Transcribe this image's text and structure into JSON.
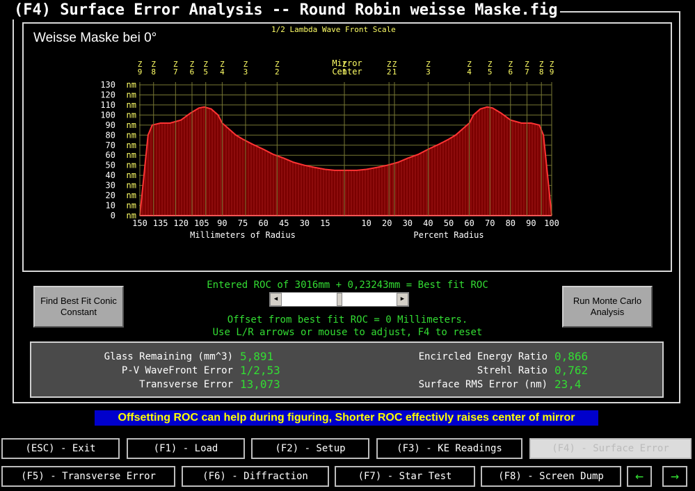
{
  "window": {
    "title": "(F4) Surface Error Analysis -- Round Robin weisse Maske.fig"
  },
  "chart": {
    "heading": "Weisse Maske bei 0°",
    "scale_label": "1/2 Lambda Wave Front Scale"
  },
  "chart_data": {
    "type": "area",
    "title": "Weisse Maske bei 0°",
    "subtitle": "1/2 Lambda Wave Front Scale",
    "y_unit": "nm",
    "ylim": [
      0,
      130
    ],
    "y_ticks": [
      "130 nm",
      "120 nm",
      "110 nm",
      "100 nm",
      "90 nm",
      "80 nm",
      "70 nm",
      "60 nm",
      "50 nm",
      "40 nm",
      "30 nm",
      "20 nm",
      "10 nm",
      "0 nm"
    ],
    "x_ticks_left": [
      "150",
      "135",
      "120",
      "105",
      "90",
      "75",
      "60",
      "45",
      "30",
      "15"
    ],
    "x_ticks_right": [
      "10",
      "20",
      "30",
      "40",
      "50",
      "60",
      "70",
      "80",
      "90",
      "100"
    ],
    "xlabel_left": "Millimeters of Radius",
    "xlabel_right": "Percent Radius",
    "zone_labels_left": [
      "Z9",
      "Z8",
      "Z7",
      "Z6",
      "Z5",
      "Z4",
      "Z3",
      "Z2",
      "Z1"
    ],
    "zone_labels_right": [
      "Z1",
      "Z2",
      "Z3",
      "Z4",
      "Z5",
      "Z6",
      "Z7",
      "Z8",
      "Z9"
    ],
    "center_label": [
      "Mirror",
      "Center"
    ],
    "x": [
      150,
      147,
      144,
      141,
      135,
      128,
      120,
      113,
      107,
      103,
      98,
      93,
      90,
      85,
      80,
      75,
      68,
      60,
      53,
      45,
      38,
      30,
      23,
      15,
      8,
      0
    ],
    "profile_nm": [
      0,
      40,
      80,
      90,
      92,
      92,
      95,
      102,
      107,
      108,
      106,
      100,
      92,
      86,
      80,
      76,
      71,
      66,
      61,
      57,
      53,
      50,
      48,
      46,
      45,
      45
    ]
  },
  "roc": {
    "entered": "Entered ROC of 3016mm + 0,23243mm = Best fit ROC",
    "offset": "Offset from best fit ROC = 0 Millimeters.",
    "hint": "Use L/R arrows or mouse to adjust, F4 to reset"
  },
  "buttons": {
    "find_conic": "Find Best Fit Conic Constant",
    "monte_carlo": "Run Monte Carlo Analysis"
  },
  "stats": {
    "glass_label": "Glass Remaining (mm^3)",
    "glass_value": "5,891",
    "pv_label": "P-V WaveFront Error",
    "pv_value": "1/2,53",
    "transverse_label": "Transverse Error",
    "transverse_value": "13,073",
    "energy_label": "Encircled Energy Ratio",
    "energy_value": "0,866",
    "strehl_label": "Strehl Ratio",
    "strehl_value": "0,762",
    "rms_label": "Surface RMS Error (nm)",
    "rms_value": "23,4"
  },
  "message": "Offsetting ROC can help during figuring, Shorter ROC effectivly raises center of mirror",
  "fkeys": {
    "esc": "(ESC) - Exit",
    "f1": "(F1) - Load",
    "f2": "(F2) - Setup",
    "f3": "(F3) - KE Readings",
    "f4": "(F4) - Surface Error",
    "f5": "(F5) - Transverse Error",
    "f6": "(F6) - Diffraction",
    "f7": "(F7) - Star Test",
    "f8": "(F8) - Screen Dump",
    "prev": "←",
    "next": "→"
  },
  "colors": {
    "fill": "#7a0000",
    "curve": "#ff3333",
    "grid": "#777733",
    "tick_label": "#ffff66",
    "value_green": "#33dd33"
  }
}
